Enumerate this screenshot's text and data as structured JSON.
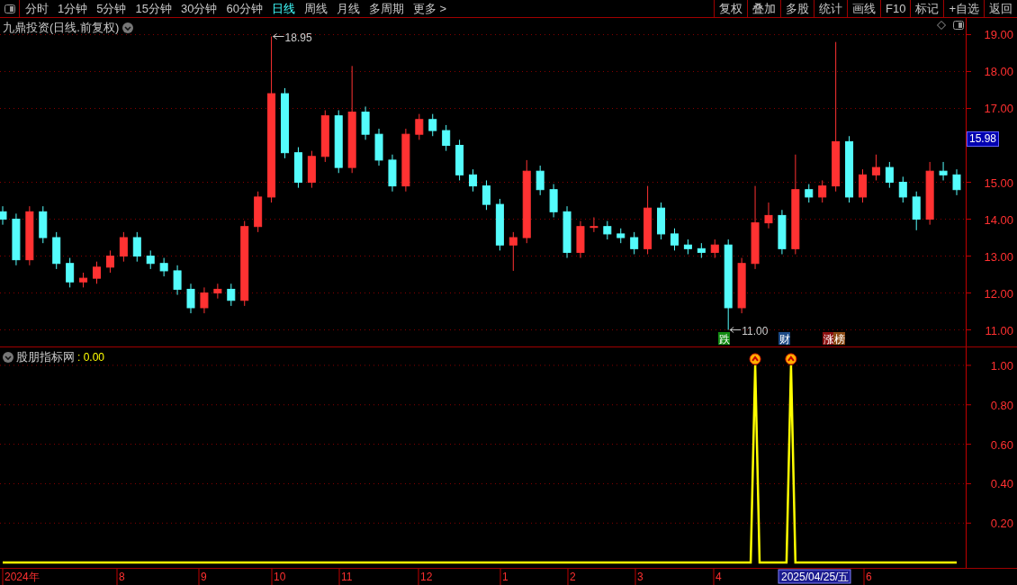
{
  "toolbar": {
    "periods": [
      {
        "label": "分时",
        "selected": false
      },
      {
        "label": "1分钟",
        "selected": false
      },
      {
        "label": "5分钟",
        "selected": false
      },
      {
        "label": "15分钟",
        "selected": false
      },
      {
        "label": "30分钟",
        "selected": false
      },
      {
        "label": "60分钟",
        "selected": false
      },
      {
        "label": "日线",
        "selected": true
      },
      {
        "label": "周线",
        "selected": false
      },
      {
        "label": "月线",
        "selected": false
      },
      {
        "label": "多周期",
        "selected": false
      },
      {
        "label": "更多 >",
        "selected": false
      }
    ],
    "actions": [
      "复权",
      "叠加",
      "多股",
      "统计",
      "画线",
      "F10",
      "标记",
      "+自选",
      "返回"
    ]
  },
  "price_panel": {
    "title": "九鼎投资(日线.前复权)",
    "current_price": "15.98",
    "extreme_labels": [
      "18.95",
      "11.00"
    ],
    "chart_data": {
      "type": "candlestick",
      "ylim": [
        10.55,
        19.45
      ],
      "yticks": [
        {
          "value": 11,
          "label": "11.00"
        },
        {
          "value": 12,
          "label": "12.00"
        },
        {
          "value": 13,
          "label": "13.00"
        },
        {
          "value": 14,
          "label": "14.00"
        },
        {
          "value": 15,
          "label": "15.00"
        },
        {
          "value": 17,
          "label": "17.00"
        },
        {
          "value": 18,
          "label": "18.00"
        },
        {
          "value": 19,
          "label": "19.00"
        }
      ],
      "categories": [
        null,
        null,
        null,
        null,
        null,
        null,
        null,
        null,
        null,
        null,
        null,
        null,
        null,
        null,
        null,
        null,
        null,
        null,
        null,
        null,
        null,
        null,
        null,
        null,
        null,
        null,
        null,
        null,
        null,
        null,
        null,
        null,
        null,
        null,
        null,
        null,
        null,
        null,
        null,
        null,
        null,
        null,
        null,
        null,
        null,
        null,
        null,
        null,
        null,
        null,
        null,
        null,
        null,
        null,
        null,
        null,
        null,
        null,
        null,
        null,
        null,
        null,
        null,
        null,
        null,
        null,
        null,
        null,
        null,
        null,
        null,
        null
      ],
      "grid": true,
      "ohlc": [
        [
          14.2,
          14.35,
          13.85,
          14.0
        ],
        [
          14.0,
          14.15,
          12.75,
          12.9
        ],
        [
          12.9,
          14.35,
          12.75,
          14.2
        ],
        [
          14.2,
          14.35,
          13.35,
          13.5
        ],
        [
          13.5,
          13.65,
          12.65,
          12.8
        ],
        [
          12.8,
          12.95,
          12.15,
          12.3
        ],
        [
          12.3,
          12.55,
          12.15,
          12.4
        ],
        [
          12.4,
          12.85,
          12.25,
          12.7
        ],
        [
          12.7,
          13.15,
          12.55,
          13.0
        ],
        [
          13.0,
          13.65,
          12.85,
          13.5
        ],
        [
          13.5,
          13.65,
          12.85,
          13.0
        ],
        [
          13.0,
          13.15,
          12.65,
          12.8
        ],
        [
          12.8,
          12.95,
          12.45,
          12.6
        ],
        [
          12.6,
          12.75,
          11.95,
          12.1
        ],
        [
          12.1,
          12.25,
          11.45,
          11.6
        ],
        [
          11.6,
          12.15,
          11.45,
          12.0
        ],
        [
          12.0,
          12.25,
          11.85,
          12.1
        ],
        [
          12.1,
          12.25,
          11.65,
          11.8
        ],
        [
          11.8,
          13.95,
          11.65,
          13.8
        ],
        [
          13.8,
          14.75,
          13.65,
          14.6
        ],
        [
          14.6,
          18.95,
          14.45,
          17.4
        ],
        [
          17.4,
          17.55,
          15.65,
          15.8
        ],
        [
          15.8,
          15.95,
          14.85,
          15.0
        ],
        [
          15.0,
          15.85,
          14.85,
          15.7
        ],
        [
          15.7,
          16.95,
          15.55,
          16.8
        ],
        [
          16.8,
          16.95,
          15.25,
          15.4
        ],
        [
          15.4,
          18.15,
          15.25,
          16.9
        ],
        [
          16.9,
          17.05,
          16.15,
          16.3
        ],
        [
          16.3,
          16.45,
          15.45,
          15.6
        ],
        [
          15.6,
          15.75,
          14.75,
          14.9
        ],
        [
          14.9,
          16.45,
          14.75,
          16.3
        ],
        [
          16.3,
          16.85,
          16.15,
          16.7
        ],
        [
          16.7,
          16.85,
          16.25,
          16.4
        ],
        [
          16.4,
          16.55,
          15.85,
          16.0
        ],
        [
          16.0,
          16.15,
          15.05,
          15.2
        ],
        [
          15.2,
          15.35,
          14.75,
          14.9
        ],
        [
          14.9,
          15.05,
          14.25,
          14.4
        ],
        [
          14.4,
          14.55,
          13.15,
          13.3
        ],
        [
          13.3,
          13.65,
          12.6,
          13.5
        ],
        [
          13.5,
          15.6,
          13.35,
          15.3
        ],
        [
          15.3,
          15.45,
          14.65,
          14.8
        ],
        [
          14.8,
          14.95,
          14.05,
          14.2
        ],
        [
          14.2,
          14.35,
          12.95,
          13.1
        ],
        [
          13.1,
          13.95,
          12.95,
          13.8
        ],
        [
          13.8,
          14.05,
          13.65,
          13.8
        ],
        [
          13.8,
          13.95,
          13.45,
          13.6
        ],
        [
          13.6,
          13.75,
          13.35,
          13.5
        ],
        [
          13.5,
          13.65,
          13.05,
          13.2
        ],
        [
          13.2,
          14.9,
          13.05,
          14.3
        ],
        [
          14.3,
          14.45,
          13.45,
          13.6
        ],
        [
          13.6,
          13.75,
          13.15,
          13.3
        ],
        [
          13.3,
          13.45,
          13.05,
          13.2
        ],
        [
          13.2,
          13.35,
          12.95,
          13.1
        ],
        [
          13.1,
          13.45,
          12.95,
          13.3
        ],
        [
          13.3,
          13.45,
          11.0,
          11.6
        ],
        [
          11.6,
          12.95,
          11.45,
          12.8
        ],
        [
          12.8,
          14.9,
          12.65,
          13.9
        ],
        [
          13.9,
          14.45,
          13.75,
          14.1
        ],
        [
          14.1,
          14.25,
          13.05,
          13.2
        ],
        [
          13.2,
          15.75,
          13.05,
          14.8
        ],
        [
          14.8,
          14.95,
          14.45,
          14.6
        ],
        [
          14.6,
          15.05,
          14.45,
          14.9
        ],
        [
          14.9,
          18.8,
          14.75,
          16.1
        ],
        [
          16.1,
          16.25,
          14.45,
          14.6
        ],
        [
          14.6,
          15.35,
          14.45,
          15.2
        ],
        [
          15.2,
          15.75,
          15.05,
          15.4
        ],
        [
          15.4,
          15.55,
          14.85,
          15.0
        ],
        [
          15.0,
          15.15,
          14.45,
          14.6
        ],
        [
          14.6,
          14.75,
          13.7,
          14.0
        ],
        [
          14.0,
          15.55,
          13.85,
          15.3
        ],
        [
          15.3,
          15.55,
          15.05,
          15.2
        ],
        [
          15.2,
          15.35,
          14.65,
          14.8
        ]
      ]
    },
    "event_badges": [
      {
        "label": "跌",
        "color": "#108a10"
      },
      {
        "label": "财",
        "color": "#1c4a86"
      },
      {
        "label": "涨",
        "color": "#8a1010"
      },
      {
        "label": "榜",
        "color": "#8a4a14"
      }
    ]
  },
  "indicator_panel": {
    "name": "股朋指标网",
    "value": ": 0.00",
    "chart_data": {
      "type": "line",
      "grid": true,
      "ylim": [
        -0.027,
        1.091
      ],
      "yticks": [
        {
          "value": 0.2,
          "label": "0.20"
        },
        {
          "value": 0.4,
          "label": "0.40"
        },
        {
          "value": 0.6,
          "label": "0.60"
        },
        {
          "value": 0.8,
          "label": "0.80"
        },
        {
          "value": 1.0,
          "label": "1.00"
        }
      ],
      "categories": [
        null,
        null,
        null,
        null,
        null,
        null,
        null,
        null,
        null,
        null,
        null,
        null,
        null,
        null,
        null,
        null,
        null,
        null,
        null,
        null,
        null,
        null,
        null,
        null,
        null,
        null,
        null,
        null,
        null,
        null,
        null,
        null,
        null,
        null,
        null,
        null,
        null,
        null,
        null,
        null,
        null,
        null,
        null,
        null,
        null,
        null,
        null,
        null,
        null,
        null,
        null,
        null,
        null,
        null,
        null,
        null,
        null,
        null,
        null,
        null,
        null,
        null,
        null,
        null,
        null,
        null,
        null,
        null,
        null,
        null,
        null,
        null,
        null,
        null,
        null,
        null,
        null,
        null,
        null,
        null,
        null,
        null,
        null,
        null,
        null,
        null,
        null,
        null,
        null,
        null,
        null,
        null,
        null,
        null,
        null,
        null,
        null,
        null,
        null,
        null,
        null,
        null,
        null,
        null,
        null,
        null,
        null,
        null,
        null,
        null,
        null,
        null,
        null,
        null,
        null,
        null,
        null,
        null,
        null,
        null,
        null,
        null,
        null,
        null,
        null,
        null,
        null,
        null,
        null,
        null,
        null,
        null,
        null,
        null,
        null,
        null,
        null,
        null,
        null,
        null,
        null,
        null,
        null,
        null,
        null,
        null,
        null,
        null,
        null,
        null,
        null,
        null,
        null,
        null,
        null,
        null,
        null,
        null,
        null,
        null,
        null,
        null,
        null,
        null,
        null,
        null,
        null,
        null,
        null,
        null,
        null,
        null,
        null,
        null,
        null,
        null,
        null,
        null,
        null,
        null,
        null,
        null,
        null,
        null,
        null,
        null,
        null,
        null,
        null,
        null,
        null,
        null,
        null,
        null,
        null,
        null,
        null,
        null,
        null,
        null,
        null,
        null,
        null,
        null,
        null,
        null,
        null,
        null,
        null,
        null,
        null,
        null,
        null,
        null
      ],
      "series": [
        {
          "color": "#ffff00",
          "values": [
            0,
            0,
            0,
            0,
            0,
            0,
            0,
            0,
            0,
            0,
            0,
            0,
            0,
            0,
            0,
            0,
            0,
            0,
            0,
            0,
            0,
            0,
            0,
            0,
            0,
            0,
            0,
            0,
            0,
            0,
            0,
            0,
            0,
            0,
            0,
            0,
            0,
            0,
            0,
            0,
            0,
            0,
            0,
            0,
            0,
            0,
            0,
            0,
            0,
            0,
            0,
            0,
            0,
            0,
            0,
            0,
            0,
            0,
            0,
            0,
            0,
            0,
            0,
            0,
            0,
            0,
            0,
            0,
            0,
            0,
            0,
            0,
            0,
            0,
            0,
            0,
            0,
            0,
            0,
            0,
            0,
            0,
            0,
            0,
            0,
            0,
            0,
            0,
            0,
            0,
            0,
            0,
            0,
            0,
            0,
            0,
            0,
            0,
            0,
            0,
            0,
            0,
            0,
            0,
            0,
            0,
            0,
            0,
            0,
            0,
            0,
            0,
            0,
            0,
            0,
            0,
            0,
            0,
            0,
            0,
            0,
            0,
            0,
            0,
            0,
            0,
            0,
            0,
            0,
            0,
            0,
            0,
            0,
            0,
            0,
            0,
            0,
            0,
            0,
            0,
            0,
            0,
            0,
            0,
            0,
            0,
            0,
            0,
            0,
            0,
            0,
            0,
            0,
            0,
            0,
            0,
            0,
            0,
            0,
            0,
            0,
            0,
            0,
            0,
            0,
            0,
            0,
            0,
            1,
            0,
            0,
            0,
            0,
            0,
            0,
            0,
            1,
            0,
            0,
            0,
            0,
            0,
            0,
            0,
            0,
            0,
            0,
            0,
            0,
            0,
            0,
            0,
            0,
            0,
            0,
            0,
            0,
            0,
            0,
            0,
            0,
            0,
            0,
            0,
            0,
            0,
            0,
            0,
            0,
            0,
            0,
            0,
            0,
            0
          ]
        }
      ]
    }
  },
  "time_axis": {
    "labels": [
      "2024年",
      "8",
      "9",
      "10",
      "11",
      "12",
      "1",
      "2",
      "3",
      "4",
      "6"
    ],
    "cursor": "2025/04/25/五"
  }
}
